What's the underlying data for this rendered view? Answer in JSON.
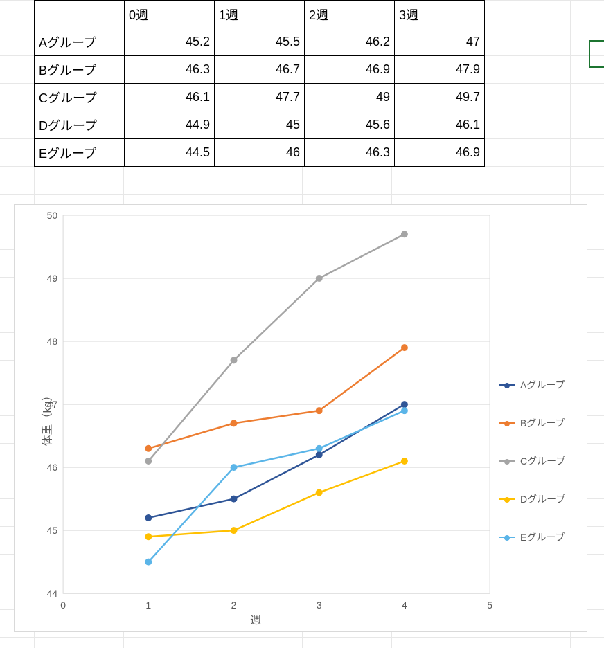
{
  "table": {
    "headers": [
      "",
      "0週",
      "1週",
      "2週",
      "3週"
    ],
    "rows": [
      {
        "label": "Aグループ",
        "values": [
          "45.2",
          "45.5",
          "46.2",
          "47"
        ]
      },
      {
        "label": "Bグループ",
        "values": [
          "46.3",
          "46.7",
          "46.9",
          "47.9"
        ]
      },
      {
        "label": "Cグループ",
        "values": [
          "46.1",
          "47.7",
          "49",
          "49.7"
        ]
      },
      {
        "label": "Dグループ",
        "values": [
          "44.9",
          "45",
          "45.6",
          "46.1"
        ]
      },
      {
        "label": "Eグループ",
        "values": [
          "44.5",
          "46",
          "46.3",
          "46.9"
        ]
      }
    ]
  },
  "chart_data": {
    "type": "line",
    "xlabel": "週",
    "ylabel": "体重（kg）",
    "x": [
      1,
      2,
      3,
      4
    ],
    "xlim": [
      0,
      5
    ],
    "ylim": [
      44,
      50
    ],
    "xticks": [
      0,
      1,
      2,
      3,
      4,
      5
    ],
    "yticks": [
      44,
      45,
      46,
      47,
      48,
      49,
      50
    ],
    "series": [
      {
        "name": "Aグループ",
        "values": [
          45.2,
          45.5,
          46.2,
          47.0
        ],
        "color": "#2f5597"
      },
      {
        "name": "Bグループ",
        "values": [
          46.3,
          46.7,
          46.9,
          47.9
        ],
        "color": "#ed7d31"
      },
      {
        "name": "Cグループ",
        "values": [
          46.1,
          47.7,
          49.0,
          49.7
        ],
        "color": "#a5a5a5"
      },
      {
        "name": "Dグループ",
        "values": [
          44.9,
          45.0,
          45.6,
          46.1
        ],
        "color": "#ffc000"
      },
      {
        "name": "Eグループ",
        "values": [
          44.5,
          46.0,
          46.3,
          46.9
        ],
        "color": "#5bb5e8"
      }
    ]
  },
  "legend_items": [
    {
      "label": "Aグループ",
      "color": "#2f5597"
    },
    {
      "label": "Bグループ",
      "color": "#ed7d31"
    },
    {
      "label": "Cグループ",
      "color": "#a5a5a5"
    },
    {
      "label": "Dグループ",
      "color": "#ffc000"
    },
    {
      "label": "Eグループ",
      "color": "#5bb5e8"
    }
  ]
}
